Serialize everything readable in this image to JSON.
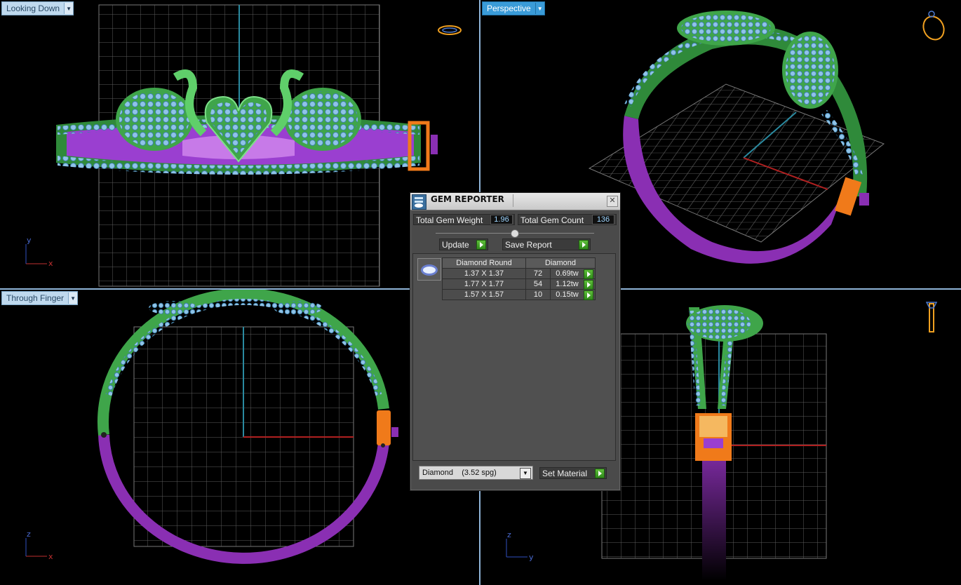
{
  "viewports": {
    "top_left": {
      "label": "Looking Down",
      "axis_h": "x",
      "axis_v": "y"
    },
    "top_right": {
      "label": "Perspective"
    },
    "bottom_left": {
      "label": "Through Finger",
      "axis_h": "x",
      "axis_v": "z"
    },
    "bottom_right": {
      "axis_h": "y",
      "axis_v": "z"
    }
  },
  "gem_reporter": {
    "title": "GEM REPORTER",
    "close_glyph": "✕",
    "total_weight_label": "Total Gem Weight",
    "total_weight_value": "1.96",
    "total_count_label": "Total Gem Count",
    "total_count_value": "136",
    "update_label": "Update",
    "save_report_label": "Save Report",
    "table": {
      "headers": [
        "Diamond Round",
        "Diamond"
      ],
      "rows": [
        {
          "size": "1.37 X 1.37",
          "count": "72",
          "weight": "0.69tw"
        },
        {
          "size": "1.77 X 1.77",
          "count": "54",
          "weight": "1.12tw"
        },
        {
          "size": "1.57 X 1.57",
          "count": "10",
          "weight": "0.15tw"
        }
      ]
    },
    "material_select": "Diamond    (3.52 spg)",
    "set_material_label": "Set Material"
  },
  "colors": {
    "metal_green": "#3fa54a",
    "shank_purple": "#8a2fb3",
    "hinge_orange": "#f07a1a",
    "gem_blue": "#8fc3e8",
    "grid": "#6a6a6a",
    "accent_blue": "#3a9bd8"
  },
  "icons": {
    "ring_thumbnail": "ring-icon",
    "gem": "round-diamond-icon"
  }
}
